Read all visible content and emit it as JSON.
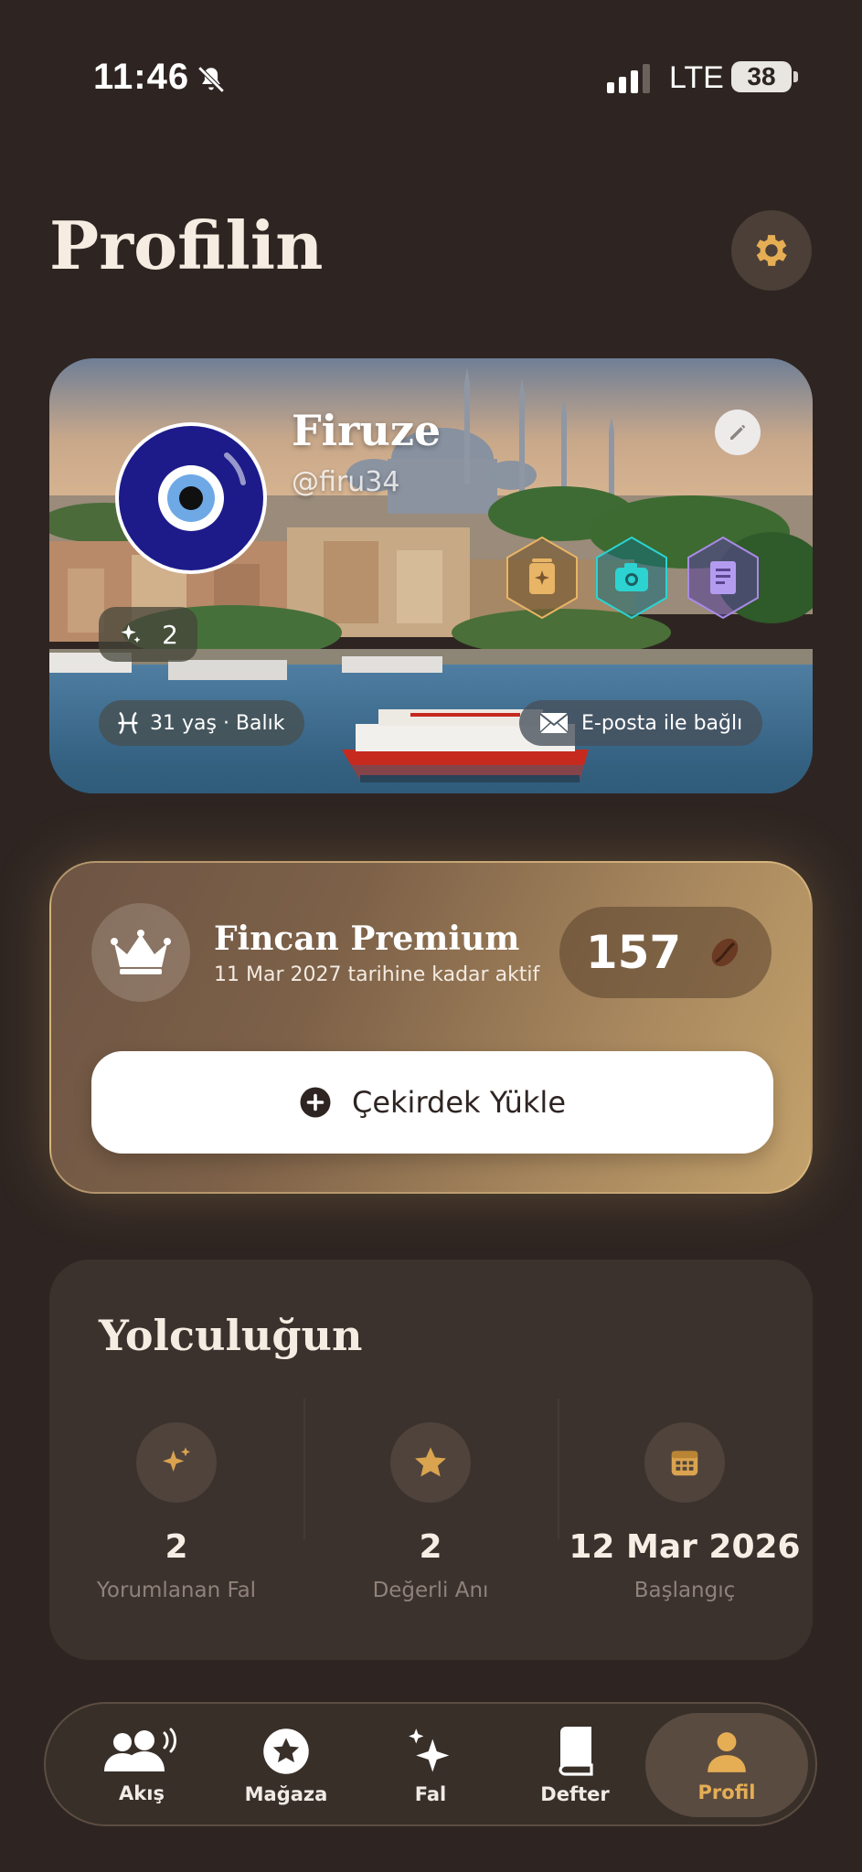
{
  "status_bar": {
    "time": "11:46",
    "network": "LTE",
    "battery": "38"
  },
  "header": {
    "title": "Profilin"
  },
  "profile": {
    "name": "Firuze",
    "handle": "@firu34",
    "fortune_count": "2",
    "zodiac": "31 yaş · Balık",
    "email_status": "E-posta ile bağlı",
    "badges": [
      "fortune-card-icon",
      "camera-icon",
      "book-icon"
    ]
  },
  "premium": {
    "title": "Fincan Premium",
    "subtitle": "11 Mar 2027 tarihine kadar aktif",
    "beans": "157",
    "load_button": "Çekirdek Yükle",
    "accent": "#c4a26c"
  },
  "journey": {
    "title": "Yolculuğun",
    "stats": [
      {
        "value": "2",
        "label": "Yorumlanan Fal",
        "icon": "sparkles-icon"
      },
      {
        "value": "2",
        "label": "Değerli Anı",
        "icon": "star-icon"
      },
      {
        "value": "12 Mar 2026",
        "label": "Başlangıç",
        "icon": "calendar-icon"
      }
    ]
  },
  "nav": {
    "items": [
      {
        "label": "Akış",
        "icon": "people-icon"
      },
      {
        "label": "Mağaza",
        "icon": "store-star-icon"
      },
      {
        "label": "Fal",
        "icon": "sparkles-icon"
      },
      {
        "label": "Defter",
        "icon": "book-icon"
      },
      {
        "label": "Profil",
        "icon": "person-icon",
        "active": true
      }
    ],
    "active_color": "#e5ae55"
  }
}
